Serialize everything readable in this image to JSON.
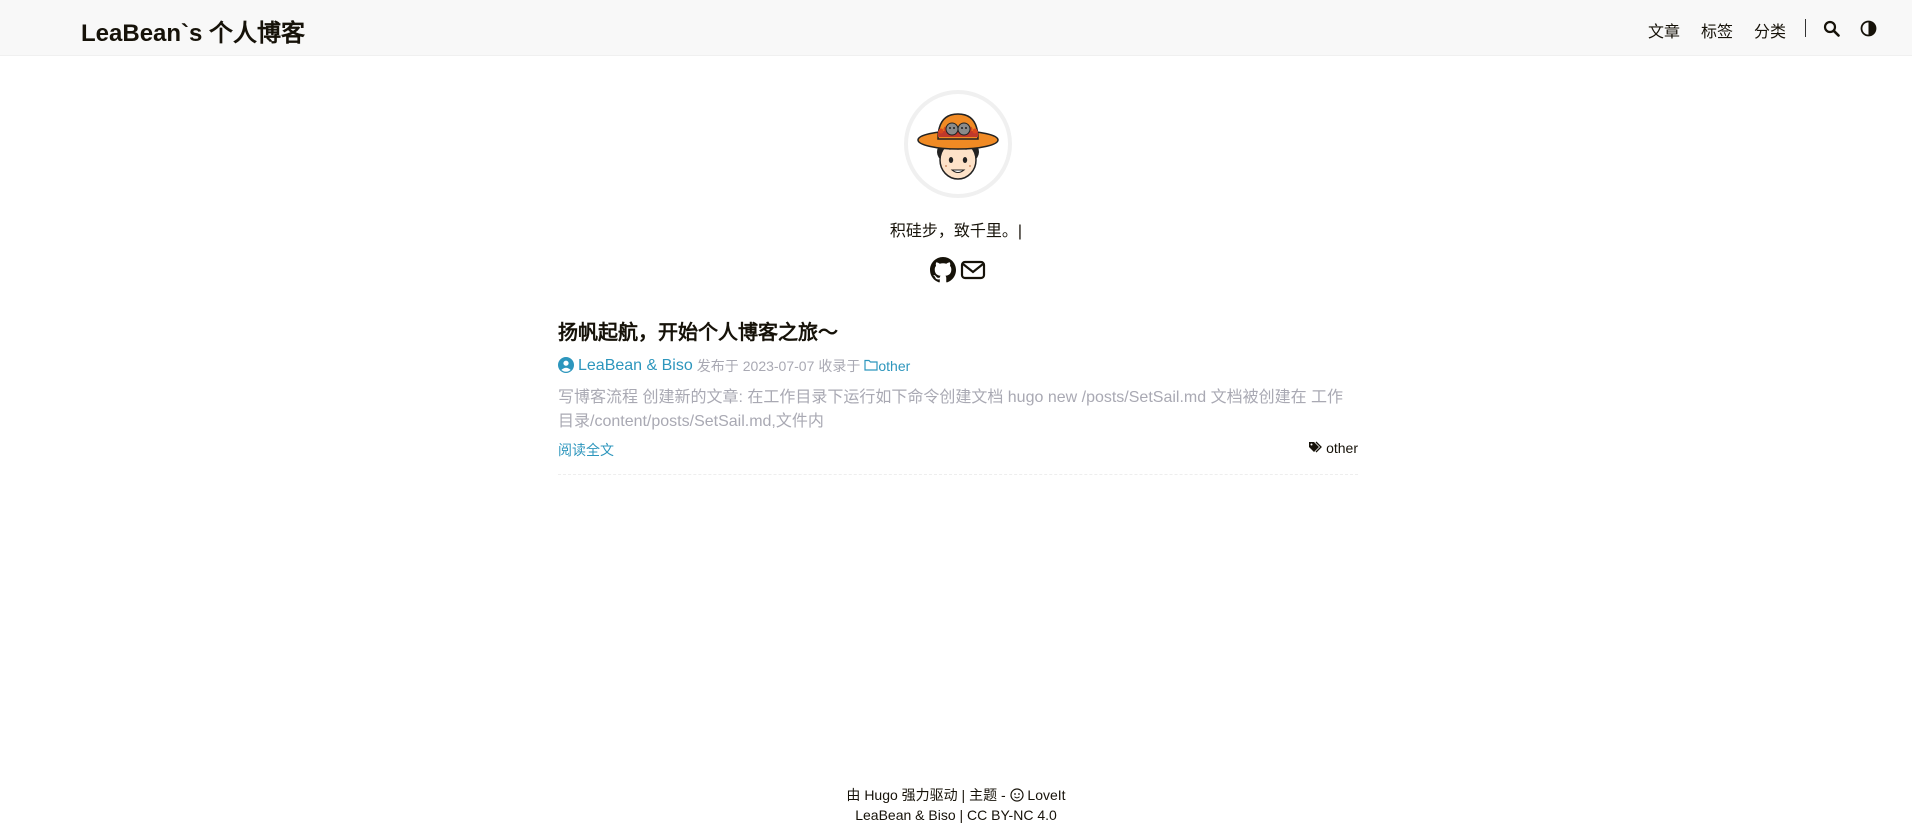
{
  "header": {
    "site_title": "LeaBean`s 个人博客",
    "menu": [
      {
        "label": "文章"
      },
      {
        "label": "标签"
      },
      {
        "label": "分类"
      }
    ],
    "search_icon": "search-icon",
    "theme_icon": "theme-switch-icon"
  },
  "profile": {
    "avatar_icon": "avatar-cartoon-orange-hat",
    "subtitle": "积硅步，致千里。|",
    "social": [
      {
        "icon": "github-icon"
      },
      {
        "icon": "email-icon"
      }
    ]
  },
  "post": {
    "title": "扬帆起航，开始个人博客之旅～",
    "author": "LeaBean & Biso",
    "published_prefix": "发布于",
    "date": "2023-07-07",
    "collected_prefix": "收录于",
    "category": "other",
    "summary": "写博客流程 创建新的文章: 在工作目录下运行如下命令创建文档 hugo new /posts/SetSail.md 文档被创建在 工作目录/content/posts/SetSail.md,文件内",
    "read_more": "阅读全文",
    "tag": "other"
  },
  "footer": {
    "powered_prefix": "由",
    "hugo": "Hugo",
    "powered_suffix": "强力驱动 | 主题 -",
    "theme_name": "LoveIt",
    "line2": "LeaBean & Biso | CC BY-NC 4.0"
  },
  "colors": {
    "accent": "#2d96bd",
    "muted": "#a9a9b3",
    "header_bg": "#f8f8f8",
    "hat": "#f08a24"
  }
}
